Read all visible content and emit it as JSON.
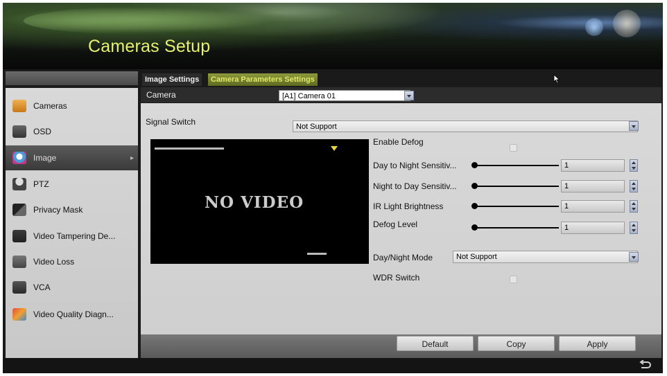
{
  "header": {
    "title": "Cameras Setup"
  },
  "tabs": [
    {
      "label": "Image Settings",
      "active": false
    },
    {
      "label": "Camera Parameters Settings",
      "active": true
    }
  ],
  "sidebar": {
    "items": [
      {
        "label": "Cameras",
        "icon": "camera-icon",
        "color": "#e8a23a"
      },
      {
        "label": "OSD",
        "icon": "osd-icon",
        "color": "#555"
      },
      {
        "label": "Image",
        "icon": "image-icon",
        "color": "#4c9ad8",
        "active": true
      },
      {
        "label": "PTZ",
        "icon": "ptz-icon",
        "color": "#444"
      },
      {
        "label": "Privacy Mask",
        "icon": "privacy-mask-icon",
        "color": "#333"
      },
      {
        "label": "Video Tampering De...",
        "icon": "video-tampering-icon",
        "color": "#333"
      },
      {
        "label": "Video Loss",
        "icon": "video-loss-icon",
        "color": "#555"
      },
      {
        "label": "VCA",
        "icon": "vca-icon",
        "color": "#444"
      },
      {
        "label": "Video Quality Diagn...",
        "icon": "video-quality-icon",
        "color": "#c84a3a"
      }
    ]
  },
  "camera": {
    "label": "Camera",
    "value": "[A1] Camera 01"
  },
  "signal_switch": {
    "label": "Signal Switch",
    "value": "Not Support"
  },
  "preview": {
    "text": "NO VIDEO"
  },
  "settings": {
    "enable_defog": {
      "label": "Enable Defog",
      "checked": false
    },
    "day_to_night": {
      "label": "Day to Night Sensitiv...",
      "value": "1"
    },
    "night_to_day": {
      "label": "Night to Day Sensitiv...",
      "value": "1"
    },
    "ir_light": {
      "label": "IR Light Brightness",
      "value": "1"
    },
    "defog_level": {
      "label": "Defog Level",
      "value": "1"
    },
    "day_night_mode": {
      "label": "Day/Night Mode",
      "value": "Not Support"
    },
    "wdr_switch": {
      "label": "WDR Switch",
      "checked": false
    }
  },
  "buttons": {
    "default": "Default",
    "copy": "Copy",
    "apply": "Apply"
  },
  "colors": {
    "accent": "#e8f070",
    "tab_active": "#6e7a28",
    "sidebar_active": "#4a4a4a"
  }
}
